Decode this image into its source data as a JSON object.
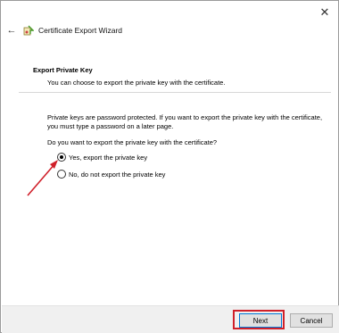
{
  "window": {
    "close_glyph": "✕"
  },
  "header": {
    "back_glyph": "←",
    "title": "Certificate Export Wizard",
    "icon": "certificate-wizard-icon"
  },
  "page": {
    "section_title": "Export Private Key",
    "section_subtitle": "You can choose to export the private key with the certificate.",
    "description": "Private keys are password protected. If you want to export the private key with the certificate, you must type a password on a later page.",
    "question": "Do you want to export the private key with the certificate?"
  },
  "options": [
    {
      "label": "Yes, export the private key",
      "checked": true
    },
    {
      "label": "No, do not export the private key",
      "checked": false
    }
  ],
  "footer": {
    "next_label": "Next",
    "cancel_label": "Cancel"
  },
  "colors": {
    "annotation_red": "#d0202a",
    "focus_blue": "#0078d7"
  }
}
